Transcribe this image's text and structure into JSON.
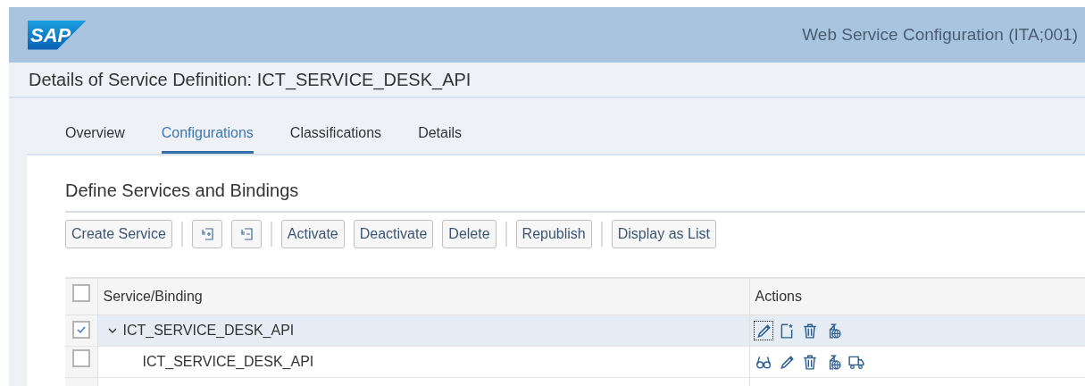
{
  "header": {
    "logo": "SAP",
    "title": "Web Service Configuration (ITA;001)"
  },
  "page_title": "Details of Service Definition: ICT_SERVICE_DESK_API",
  "tabs": [
    {
      "label": "Overview",
      "selected": false
    },
    {
      "label": "Configurations",
      "selected": true
    },
    {
      "label": "Classifications",
      "selected": false
    },
    {
      "label": "Details",
      "selected": false
    }
  ],
  "section_title": "Define Services and Bindings",
  "toolbar": [
    {
      "kind": "button",
      "label": "Create Service"
    },
    {
      "kind": "separator"
    },
    {
      "kind": "expand-all"
    },
    {
      "kind": "collapse-all"
    },
    {
      "kind": "separator"
    },
    {
      "kind": "button",
      "label": "Activate"
    },
    {
      "kind": "button",
      "label": "Deactivate"
    },
    {
      "kind": "button",
      "label": "Delete"
    },
    {
      "kind": "separator"
    },
    {
      "kind": "button",
      "label": "Republish"
    },
    {
      "kind": "separator"
    },
    {
      "kind": "button",
      "label": "Display as List"
    }
  ],
  "table": {
    "columns": [
      "Service/Binding",
      "Actions"
    ],
    "all_checked": false,
    "rows": [
      {
        "label": "ICT_SERVICE_DESK_API",
        "checked": true,
        "selected": true,
        "expanded": true,
        "actions": [
          {
            "kind": "edit",
            "focused": true
          },
          {
            "kind": "new-document",
            "focused": false
          },
          {
            "kind": "delete",
            "focused": false
          },
          {
            "kind": "document-globe",
            "focused": false
          }
        ],
        "children": [
          {
            "label": "ICT_SERVICE_DESK_API",
            "checked": false,
            "selected": false,
            "actions": [
              {
                "kind": "glasses",
                "focused": false
              },
              {
                "kind": "edit",
                "focused": false
              },
              {
                "kind": "delete",
                "focused": false
              },
              {
                "kind": "document-globe",
                "focused": false
              },
              {
                "kind": "truck",
                "focused": false
              }
            ]
          }
        ]
      }
    ]
  }
}
